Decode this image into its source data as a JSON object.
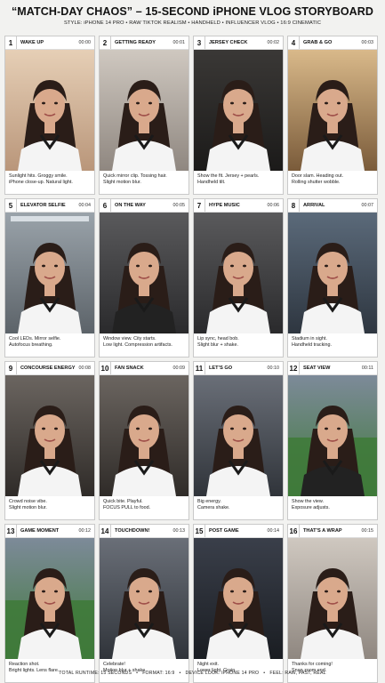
{
  "header": {
    "title": "“MATCH-DAY CHAOS” – 15-SECOND iPHONE VLOG STORYBOARD",
    "subtitle": "STYLE: iPHONE 14 PRO • RAW TIKTOK REALISM • HANDHELD • INFLUENCER VLOG • 16:9 CINEMATIC"
  },
  "panels": [
    {
      "num": "1",
      "title": "WAKE UP",
      "time": "00:00",
      "caption": [
        "Sunlight hits. Groggy smile.",
        "iPhone close-up. Natural light."
      ],
      "scene": "bedroom",
      "jersey": "sweater"
    },
    {
      "num": "2",
      "title": "GETTING READY",
      "time": "00:01",
      "caption": [
        "Quick mirror clip. Tossing hair.",
        "Slight motion blur."
      ],
      "scene": "room",
      "jersey": "white"
    },
    {
      "num": "3",
      "title": "JERSEY CHECK",
      "time": "00:02",
      "caption": [
        "Show the fit. Jersey + pearls.",
        "Handheld tilt."
      ],
      "scene": "dark",
      "jersey": "white"
    },
    {
      "num": "4",
      "title": "GRAB & GO",
      "time": "00:03",
      "caption": [
        "Door slam. Heading out.",
        "Rolling shutter wobble."
      ],
      "scene": "door",
      "jersey": "white"
    },
    {
      "num": "5",
      "title": "ELEVATOR SELFIE",
      "time": "00:04",
      "caption": [
        "Cool LEDs. Mirror selfie.",
        "Autofocus breathing."
      ],
      "scene": "elevator",
      "jersey": "white"
    },
    {
      "num": "6",
      "title": "ON THE WAY",
      "time": "00:05",
      "caption": [
        "Window view. City starts.",
        "Low light. Compression artifacts."
      ],
      "scene": "car",
      "jersey": "black"
    },
    {
      "num": "7",
      "title": "HYPE MUSIC",
      "time": "00:06",
      "caption": [
        "Lip sync, head bob.",
        "Slight blur + shake."
      ],
      "scene": "car",
      "jersey": "white"
    },
    {
      "num": "8",
      "title": "ARRIVAL",
      "time": "00:07",
      "caption": [
        "Stadium in sight.",
        "Handheld tracking."
      ],
      "scene": "outdoor",
      "jersey": "white"
    },
    {
      "num": "9",
      "title": "CONCOURSE ENERGY",
      "time": "00:08",
      "caption": [
        "Crowd noise vibe.",
        "Slight motion blur."
      ],
      "scene": "concourse",
      "jersey": "white"
    },
    {
      "num": "10",
      "title": "FAN SNACK",
      "time": "00:09",
      "caption": [
        "Quick bite. Playful.",
        "FOCUS PULL to food."
      ],
      "scene": "concourse",
      "jersey": "white"
    },
    {
      "num": "11",
      "title": "LET’S GO",
      "time": "00:10",
      "caption": [
        "Big energy.",
        "Camera shake."
      ],
      "scene": "stands",
      "jersey": "white"
    },
    {
      "num": "12",
      "title": "SEAT VIEW",
      "time": "00:11",
      "caption": [
        "Show the view.",
        "Exposure adjusts."
      ],
      "scene": "field",
      "jersey": "black"
    },
    {
      "num": "13",
      "title": "GAME MOMENT",
      "time": "00:12",
      "caption": [
        "Reaction shot.",
        "Bright lights. Lens flare."
      ],
      "scene": "field",
      "jersey": "white"
    },
    {
      "num": "14",
      "title": "TOUCHDOWN!",
      "time": "00:13",
      "caption": [
        "Celebrate!",
        "Motion blur + shake."
      ],
      "scene": "stands",
      "jersey": "white"
    },
    {
      "num": "15",
      "title": "POST GAME",
      "time": "00:14",
      "caption": [
        "Night exit.",
        "Lower light. Grain."
      ],
      "scene": "night",
      "jersey": "white"
    },
    {
      "num": "16",
      "title": "THAT’S A WRAP",
      "time": "00:15",
      "caption": [
        "Thanks for coming!",
        "Snap zoom end."
      ],
      "scene": "room",
      "jersey": "white"
    }
  ],
  "footer": {
    "items": [
      "TOTAL RUNTIME: 15 SECONDS",
      "FORMAT: 16:9",
      "DEVICE LOOK: iPHONE 14 PRO",
      "FEEL: RAW, FAST, REAL"
    ]
  },
  "colors": {
    "skin": "#d9a98c",
    "hair": "#2a1d18",
    "jersey_white": "#f4f4f4",
    "jersey_trim": "#1a1a1a",
    "grass": "#3f7a3a"
  }
}
